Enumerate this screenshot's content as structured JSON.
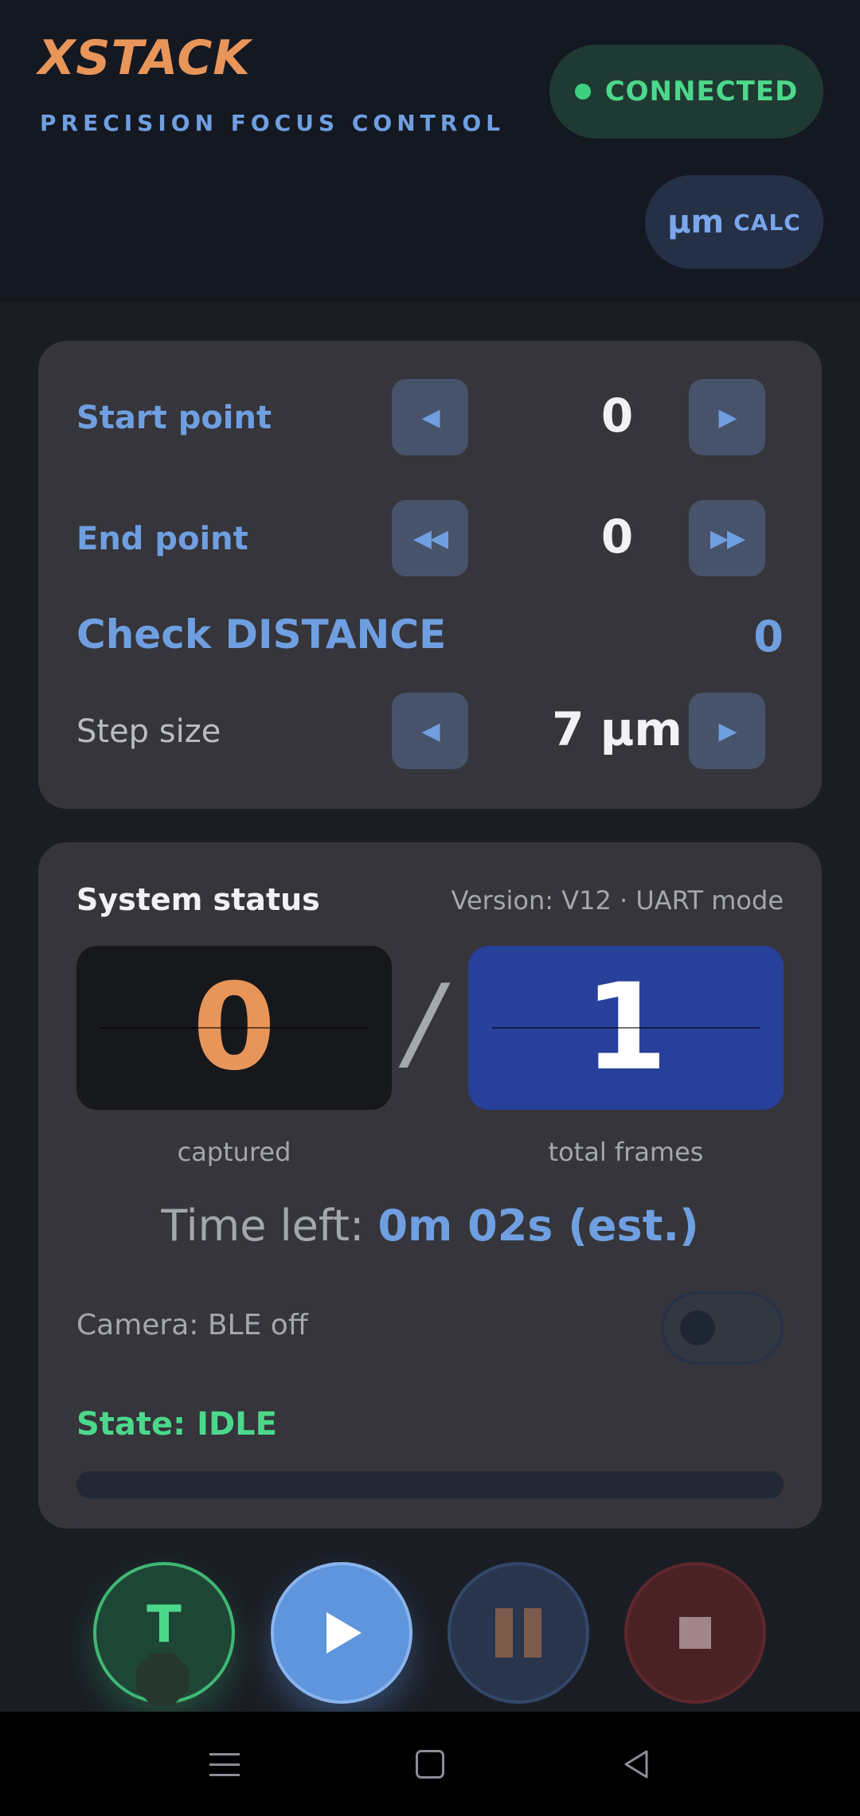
{
  "header": {
    "app_name": "XSTACK",
    "subtitle": "PRECISION FOCUS CONTROL",
    "connection_status": "CONNECTED",
    "calc_unit": "µm",
    "calc_label": "CALC"
  },
  "focus_card": {
    "start_point": {
      "label": "Start point",
      "value": "0",
      "dec_icon": "◀",
      "inc_icon": "▶"
    },
    "end_point": {
      "label": "End point",
      "value": "0",
      "dec_icon": "◀◀",
      "inc_icon": "▶▶"
    },
    "distance": {
      "label": "Check DISTANCE",
      "value": "0"
    },
    "step_size": {
      "label": "Step size",
      "value": "7 µm",
      "dec_icon": "◀",
      "inc_icon": "▶"
    }
  },
  "status_card": {
    "title": "System status",
    "version": "Version: V12 · UART mode",
    "captured": "0",
    "captured_label": "captured",
    "separator": "/",
    "total": "1",
    "total_label": "total frames",
    "time_left_label": "Time left:",
    "time_left_value": "0m 02s (est.)",
    "camera": "Camera: BLE off",
    "camera_toggle_on": false,
    "state": "State: IDLE",
    "progress_fraction": 0
  },
  "controls": {
    "trigger_label": "T"
  },
  "colors": {
    "accent_orange": "#e8955a",
    "accent_blue": "#6f9fe0",
    "accent_green": "#4cd88b",
    "total_frames_bg": "#27409a"
  }
}
